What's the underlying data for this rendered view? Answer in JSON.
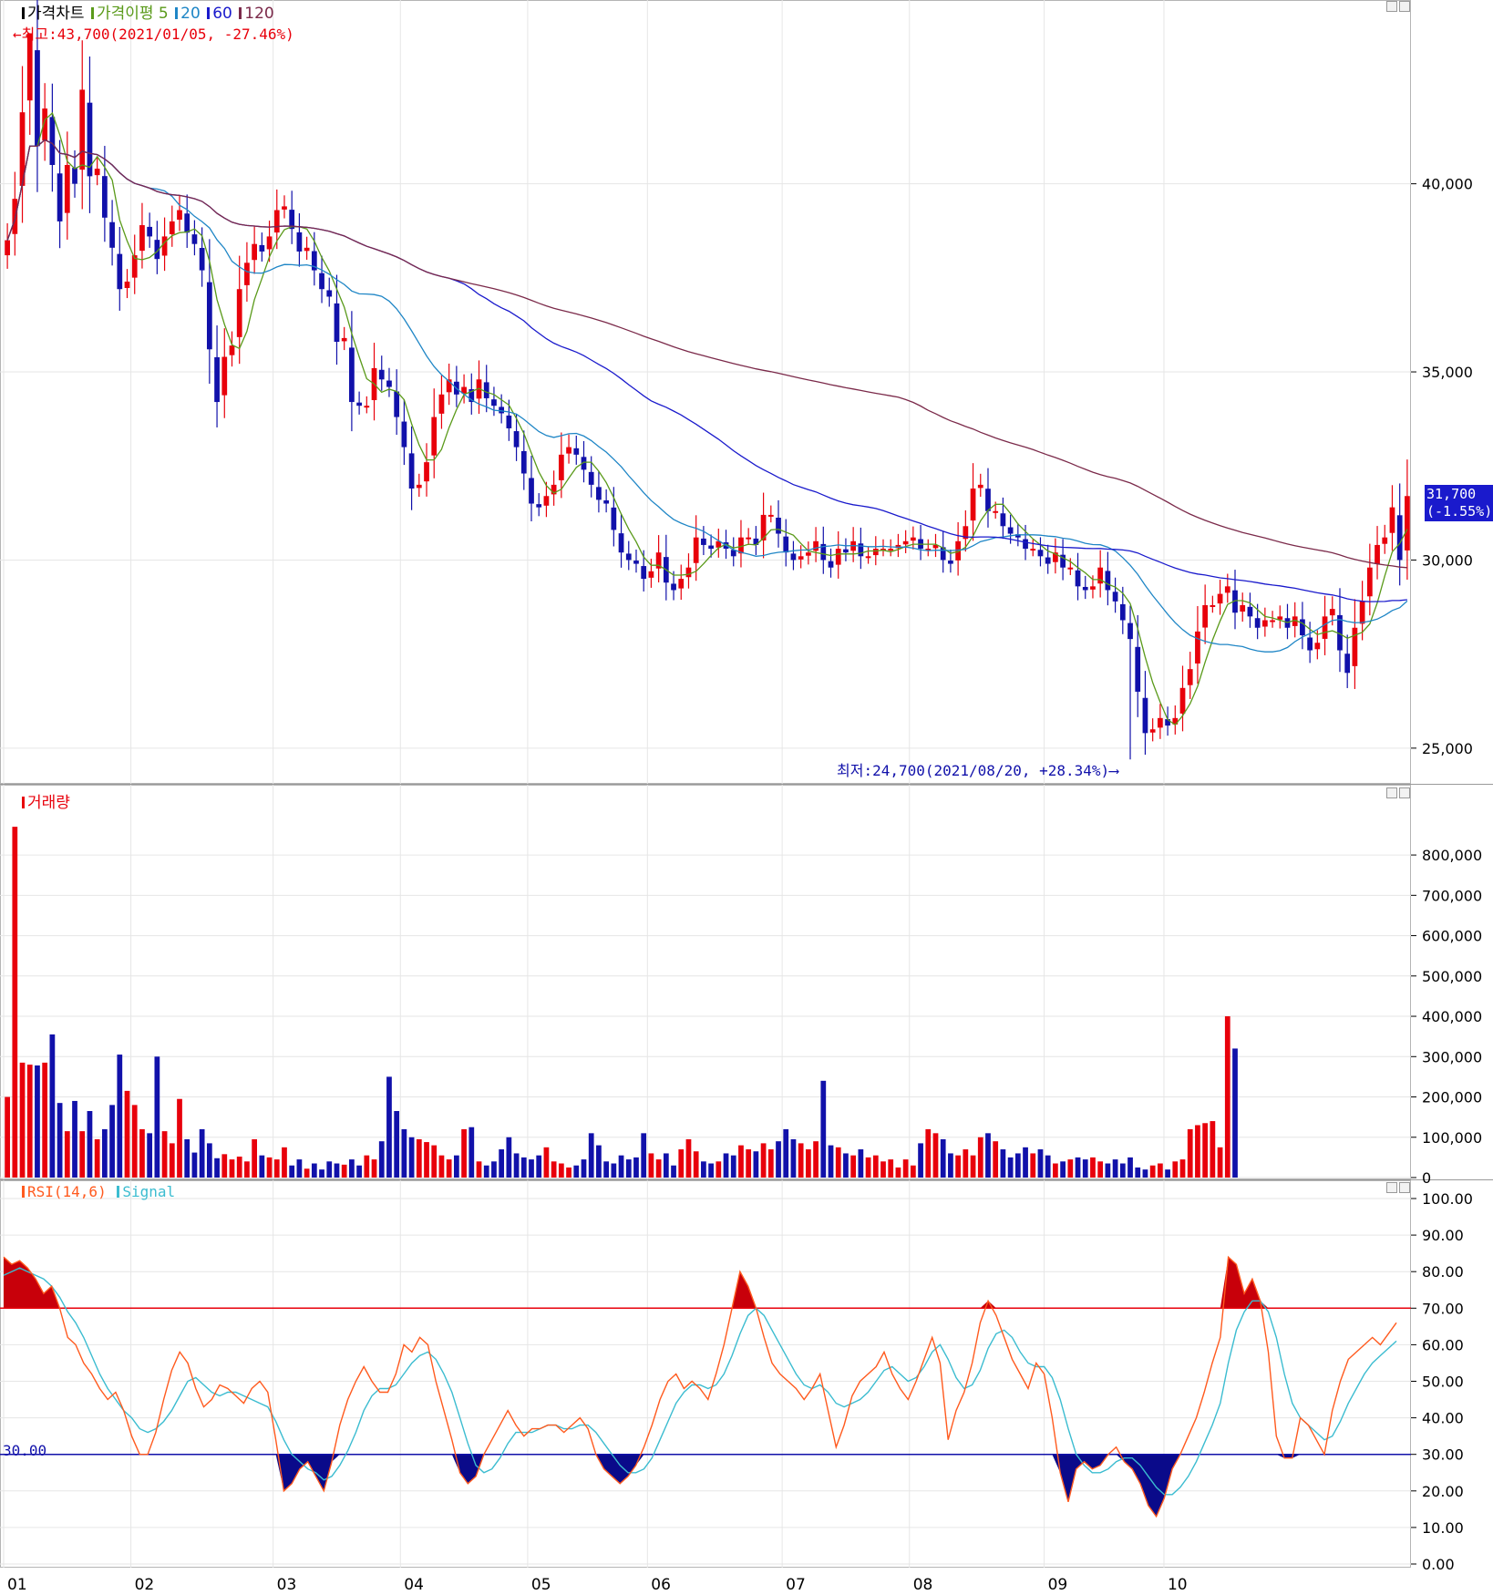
{
  "legends": {
    "price_panel": [
      {
        "label": "가격차트",
        "color": "#000000"
      },
      {
        "label": "가격이평 5",
        "color": "#5a9a1a"
      },
      {
        "label": "20",
        "color": "#1f86c6"
      },
      {
        "label": "60",
        "color": "#1a1acc"
      },
      {
        "label": "120",
        "color": "#7b2a4a"
      }
    ],
    "volume_panel": [
      {
        "label": "거래량",
        "color": "#e8000b"
      }
    ],
    "rsi_panel": [
      {
        "label": "RSI(14,6)",
        "color": "#ff5a1e"
      },
      {
        "label": "Signal",
        "color": "#3bbcd0"
      }
    ]
  },
  "annotations": {
    "high": "←최고:43,700(2021/01/05, -27.46%)",
    "low": "최저:24,700(2021/08/20, +28.34%)⟶",
    "last_price": "31,700",
    "last_change": "(-1.55%)",
    "rsi_threshold_label": "30.00"
  },
  "colors": {
    "up": "#e8000b",
    "down": "#1111aa",
    "last_price_bg": "#1a1acc",
    "grid": "#e6e6e6"
  },
  "chart_data": [
    {
      "type": "candlestick",
      "title": "가격차트",
      "x_ticks": [
        "01",
        "02",
        "03",
        "04",
        "05",
        "06",
        "07",
        "08",
        "09",
        "10"
      ],
      "y_ticks": [
        "25,000",
        "30,000",
        "35,000",
        "40,000"
      ],
      "ylim": [
        24100,
        44400
      ],
      "high": 43700,
      "low": 24700,
      "last": 31700,
      "close": [
        38500,
        39600,
        41900,
        44000,
        41000,
        42000,
        40500,
        39000,
        40500,
        40000,
        42500,
        40200,
        40400,
        39100,
        38300,
        37200,
        37400,
        38100,
        38900,
        38600,
        38000,
        38600,
        39000,
        39300,
        38700,
        38400,
        37700,
        35600,
        34200,
        35400,
        35700,
        37200,
        37900,
        38400,
        38200,
        38600,
        39300,
        39400,
        38800,
        38200,
        38300,
        37700,
        37200,
        37000,
        35800,
        35900,
        34200,
        34100,
        34100,
        35100,
        34800,
        34600,
        33800,
        33000,
        31900,
        32000,
        32600,
        33800,
        34400,
        34800,
        34400,
        34600,
        34200,
        34800,
        34300,
        34100,
        33900,
        33500,
        33000,
        32300,
        31500,
        31400,
        31700,
        32000,
        32800,
        33000,
        32800,
        32400,
        32000,
        31600,
        31500,
        30800,
        30200,
        30000,
        29900,
        29500,
        29700,
        30200,
        29400,
        29200,
        29500,
        29800,
        30600,
        30400,
        30300,
        30500,
        30300,
        30100,
        30600,
        30600,
        30400,
        31200,
        31200,
        30700,
        30200,
        30000,
        30100,
        30200,
        30500,
        30000,
        29800,
        30300,
        30200,
        30500,
        30100,
        30100,
        30300,
        30300,
        30300,
        30400,
        30500,
        30600,
        30300,
        30300,
        30400,
        30000,
        29900,
        30500,
        30900,
        31900,
        32000,
        31300,
        31300,
        30900,
        30700,
        30600,
        30300,
        30300,
        30100,
        29900,
        30200,
        29800,
        29800,
        29300,
        29200,
        29300,
        29800,
        29200,
        28900,
        28400,
        27900,
        26500,
        25400,
        25500,
        25800,
        25600,
        25800,
        26600,
        27100,
        28100,
        28800,
        28800,
        29100,
        29300,
        28600,
        28800,
        28500,
        28200,
        28400,
        28400,
        28500,
        28200,
        28500,
        28000,
        27600,
        27800,
        28500,
        28700,
        27600,
        27000,
        28200,
        28900,
        29800,
        30400,
        30600,
        31400,
        30000,
        31700
      ]
    },
    {
      "type": "bar",
      "title": "거래량",
      "y_ticks": [
        "0",
        "100,000",
        "200,000",
        "300,000",
        "400,000",
        "500,000",
        "600,000",
        "700,000",
        "800,000"
      ],
      "ylim": [
        0,
        920000
      ],
      "values": [
        200000,
        870000,
        285000,
        280000,
        278000,
        285000,
        355000,
        185000,
        115000,
        190000,
        115000,
        165000,
        95000,
        120000,
        180000,
        305000,
        215000,
        180000,
        120000,
        110000,
        300000,
        115000,
        85000,
        195000,
        95000,
        62000,
        120000,
        85000,
        48000,
        58000,
        45000,
        52000,
        40000,
        95000,
        55000,
        50000,
        45000,
        75000,
        30000,
        45000,
        22000,
        35000,
        20000,
        40000,
        35000,
        32000,
        45000,
        30000,
        55000,
        45000,
        90000,
        250000,
        165000,
        120000,
        100000,
        95000,
        88000,
        80000,
        55000,
        45000,
        55000,
        120000,
        125000,
        40000,
        30000,
        40000,
        70000,
        100000,
        60000,
        50000,
        45000,
        55000,
        75000,
        40000,
        35000,
        25000,
        30000,
        45000,
        110000,
        80000,
        40000,
        35000,
        55000,
        45000,
        50000,
        110000,
        60000,
        45000,
        60000,
        30000,
        70000,
        95000,
        65000,
        40000,
        35000,
        40000,
        60000,
        55000,
        80000,
        70000,
        65000,
        85000,
        70000,
        90000,
        120000,
        95000,
        85000,
        70000,
        90000,
        240000,
        80000,
        75000,
        60000,
        55000,
        70000,
        50000,
        55000,
        40000,
        45000,
        25000,
        45000,
        30000,
        85000,
        120000,
        110000,
        95000,
        60000,
        55000,
        70000,
        55000,
        100000,
        110000,
        90000,
        70000,
        50000,
        60000,
        75000,
        60000,
        70000,
        55000,
        35000,
        40000,
        45000,
        50000,
        45000,
        50000,
        40000,
        35000,
        45000,
        35000,
        50000,
        25000,
        20000,
        30000,
        35000,
        20000,
        40000,
        45000,
        120000,
        130000,
        135000,
        140000,
        75000,
        400000,
        320000
      ]
    },
    {
      "type": "line",
      "title": "RSI(14,6)",
      "series": [
        {
          "name": "RSI(14,6)",
          "values": [
            84,
            82,
            83,
            81,
            78,
            74,
            76,
            70,
            62,
            60,
            55,
            52,
            48,
            45,
            47,
            42,
            35,
            30,
            30,
            36,
            45,
            53,
            58,
            55,
            48,
            43,
            45,
            49,
            48,
            46,
            44,
            48,
            50,
            47,
            34,
            20,
            22,
            26,
            28,
            24,
            20,
            28,
            38,
            45,
            50,
            54,
            50,
            47,
            47,
            52,
            60,
            58,
            62,
            60,
            50,
            42,
            34,
            25,
            22,
            24,
            30,
            34,
            38,
            42,
            38,
            35,
            37,
            37,
            38,
            38,
            36,
            38,
            40,
            37,
            30,
            26,
            24,
            22,
            24,
            27,
            32,
            38,
            45,
            50,
            52,
            48,
            50,
            48,
            45,
            52,
            60,
            70,
            80,
            76,
            70,
            62,
            55,
            52,
            50,
            48,
            45,
            48,
            52,
            42,
            32,
            38,
            46,
            50,
            52,
            54,
            58,
            52,
            48,
            45,
            50,
            56,
            62,
            55,
            34,
            42,
            47,
            55,
            66,
            72,
            68,
            62,
            56,
            52,
            48,
            55,
            52,
            40,
            25,
            17,
            26,
            28,
            26,
            27,
            30,
            32,
            28,
            26,
            22,
            16,
            13,
            18,
            26,
            30,
            35,
            40,
            47,
            55,
            62,
            84,
            82,
            74,
            78,
            72,
            58,
            35,
            29,
            29,
            40,
            38,
            34,
            30,
            42,
            50,
            56,
            58,
            60,
            62,
            60,
            63,
            66
          ]
        },
        {
          "name": "Signal",
          "values": [
            79,
            80,
            81,
            80,
            79,
            78,
            76,
            73,
            69,
            66,
            62,
            57,
            52,
            48,
            45,
            42,
            40,
            37,
            36,
            37,
            39,
            42,
            46,
            50,
            51,
            49,
            47,
            46,
            47,
            47,
            46,
            45,
            44,
            43,
            39,
            34,
            30,
            28,
            26,
            25,
            23,
            24,
            27,
            31,
            36,
            42,
            46,
            48,
            48,
            49,
            52,
            55,
            57,
            58,
            56,
            52,
            47,
            40,
            33,
            27,
            25,
            26,
            29,
            33,
            36,
            36,
            36,
            37,
            38,
            38,
            37,
            37,
            38,
            38,
            36,
            33,
            30,
            27,
            25,
            25,
            26,
            29,
            34,
            39,
            44,
            47,
            49,
            49,
            48,
            49,
            52,
            57,
            63,
            68,
            70,
            68,
            64,
            60,
            56,
            52,
            49,
            48,
            49,
            47,
            44,
            43,
            44,
            45,
            47,
            50,
            53,
            54,
            52,
            50,
            51,
            54,
            58,
            60,
            56,
            51,
            48,
            49,
            53,
            59,
            63,
            64,
            62,
            58,
            55,
            54,
            54,
            51,
            45,
            37,
            30,
            27,
            25,
            25,
            26,
            28,
            29,
            29,
            27,
            24,
            21,
            19,
            19,
            21,
            24,
            28,
            33,
            38,
            44,
            55,
            64,
            69,
            72,
            72,
            69,
            62,
            52,
            44,
            40,
            38,
            36,
            34,
            35,
            39,
            44,
            48,
            52,
            55,
            57,
            59,
            61
          ]
        }
      ],
      "y_ticks": [
        "0.00",
        "10.00",
        "20.00",
        "30.00",
        "40.00",
        "50.00",
        "60.00",
        "70.00",
        "80.00",
        "90.00",
        "100.00"
      ],
      "ylim": [
        0,
        100
      ],
      "thresholds": [
        70,
        30
      ]
    }
  ]
}
